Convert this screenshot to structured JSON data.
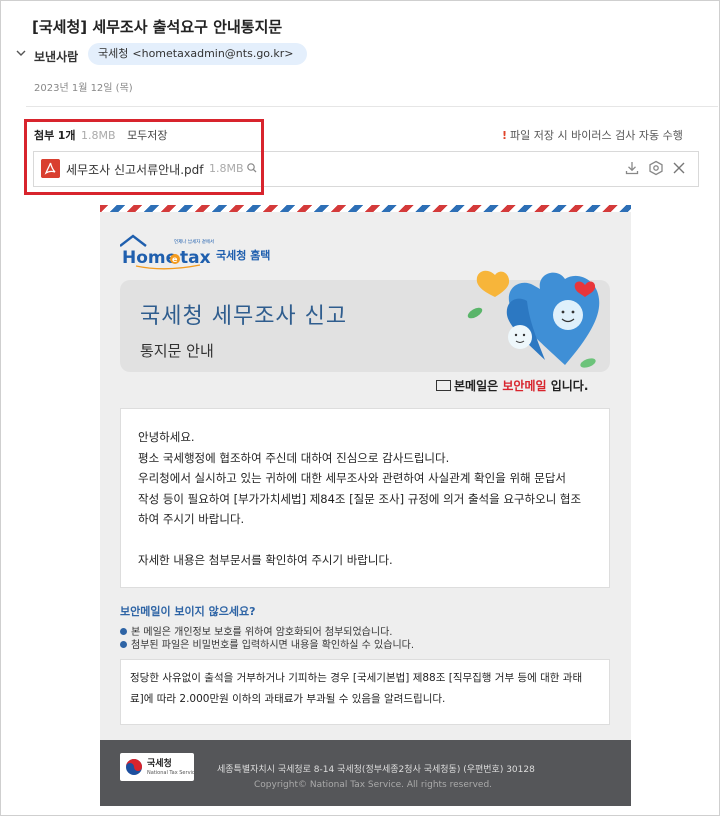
{
  "email": {
    "subject": "[국세청] 세무조사 출석요구 안내통지문",
    "sender_label": "보낸사람",
    "sender_name": "국세청",
    "sender_email": "<hometaxadmin@nts.go.kr>",
    "date": "2023년 1월 12일 (목)"
  },
  "attachments": {
    "label": "첨부",
    "count": "1개",
    "total_size": "1.8MB",
    "save_all": "모두저장",
    "warning": "파일 저장 시 바이러스 검사 자동 수행",
    "file": {
      "name": "세무조사 신고서류안내.pdf",
      "size": "1.8MB",
      "icon": "pdf-icon"
    },
    "actions": [
      "download-icon",
      "virus-scan-icon",
      "close-icon"
    ]
  },
  "mail_body": {
    "logo_tagline": "언제나 납세자 곁에서",
    "logo_text_a": "Home",
    "logo_text_b": "tax",
    "logo_text_e": "e",
    "logo_korean": "국세청 홈택스",
    "hero_title": "국세청 세무조사 신고",
    "hero_subtitle": "통지문 안내",
    "secure_prefix": "본메일은",
    "secure_highlight": "보안메일",
    "secure_suffix": "입니다.",
    "paragraph_lines": [
      "안녕하세요.",
      "평소 국세행정에 협조하여 주신데 대하여 진심으로 감사드립니다.",
      "우리청에서 실시하고 있는 귀하에 대한 세무조사와 관련하여 사실관계 확인을 위해 문답서",
      "작성 등이 필요하여 [부가가치세법] 제84조 [질문 조사] 규정에 의거 출석을 요구하오니 협조",
      "하여 주시기 바랍니다.",
      "자세한 내용은 첨부문서를 확인하여 주시기 바랍니다."
    ],
    "notice_title": "보안메일이 보이지 않으세요?",
    "notice_items": [
      "본 메일은 개인정보 보호를 위하여 암호화되어 첨부되었습니다.",
      "첨부된 파일은 비밀번호를 입력하시면 내용을 확인하실 수 있습니다."
    ],
    "warning_lines": [
      "정당한 사유없이 출석을 거부하거나 기피하는 경우 [국세기본법] 제88조 [직무집행 거부 등에 대한 과태",
      "료]에 따라 2.000만원 이하의 과태료가 부과될 수 있음을 알려드립니다."
    ],
    "footer": {
      "nts_name": "국세청",
      "nts_english": "National Tax Service",
      "address": "세종특별자치시 국세청로 8-14 국세청(정부세종2청사 국세청동) (우편번호) 30128",
      "copyright": "Copyright© National Tax Service. All rights reserved."
    }
  },
  "colors": {
    "highlight_box": "#d8242d",
    "brand_blue": "#2f5d8e",
    "chip_bg": "#e4effc",
    "pdf_red": "#d93f30"
  }
}
